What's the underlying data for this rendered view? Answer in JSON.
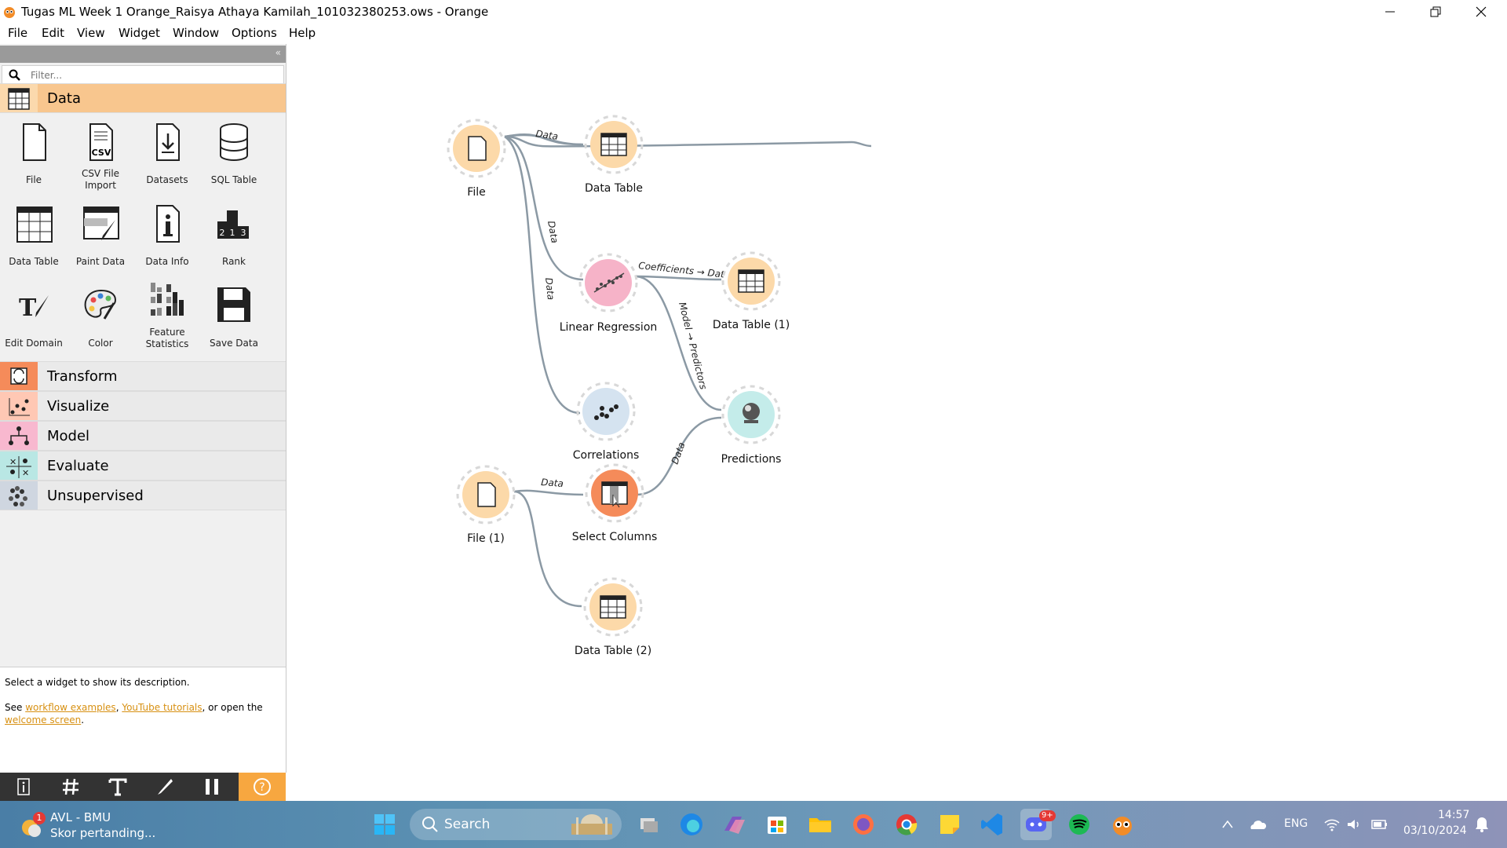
{
  "window": {
    "title": "Tugas ML Week 1 Orange_Raisya Athaya Kamilah_101032380253.ows - Orange"
  },
  "menu": [
    "File",
    "Edit",
    "View",
    "Widget",
    "Window",
    "Options",
    "Help"
  ],
  "sidebar": {
    "filter_placeholder": "Filter...",
    "categories": {
      "data": "Data",
      "transform": "Transform",
      "visualize": "Visualize",
      "model": "Model",
      "evaluate": "Evaluate",
      "unsupervised": "Unsupervised"
    },
    "widgets": {
      "file": "File",
      "csv_line1": "CSV File",
      "csv_line2": "Import",
      "datasets": "Datasets",
      "sql_table": "SQL Table",
      "data_table": "Data Table",
      "paint_data": "Paint Data",
      "data_info": "Data Info",
      "rank": "Rank",
      "edit_domain": "Edit Domain",
      "color": "Color",
      "feature_line1": "Feature",
      "feature_line2": "Statistics",
      "save_data": "Save Data"
    }
  },
  "description": {
    "line1": "Select a widget to show its description.",
    "see": "See ",
    "link_examples": "workflow examples",
    "comma": ", ",
    "link_tutorials": "YouTube tutorials",
    "or_open": ", or open the",
    "link_welcome": "welcome screen",
    "period": "."
  },
  "canvas": {
    "nodes": {
      "file": "File",
      "data_table": "Data Table",
      "linear_regression": "Linear Regression",
      "data_table_1": "Data Table (1)",
      "correlations": "Correlations",
      "predictions": "Predictions",
      "file_1": "File (1)",
      "select_columns": "Select Columns",
      "data_table_2": "Data Table (2)"
    },
    "links": {
      "file_to_table": "Data",
      "file_to_lr": "Data",
      "file_to_corr": "Data",
      "lr_to_table1": "Coefficients → Dat",
      "lr_to_pred": "Model → Predictors",
      "file1_to_select": "Data",
      "select_to_pred": "Data",
      "file1_to_table2": "Data"
    },
    "colors": {
      "data_node": "#fcd9a9",
      "model_node": "#f6b3c8",
      "visualize_node": "#d5e3f0",
      "evaluate_node": "#c4ecea",
      "transform_node": "#f58b5a",
      "link": "#8a9aa6"
    }
  },
  "taskbar": {
    "weather_title": "AVL - BMU",
    "weather_sub": "Skor pertanding...",
    "weather_badge": "1",
    "search_label": "Search",
    "discord_badge": "9+",
    "lang": "ENG",
    "time": "14:57",
    "date": "03/10/2024"
  }
}
